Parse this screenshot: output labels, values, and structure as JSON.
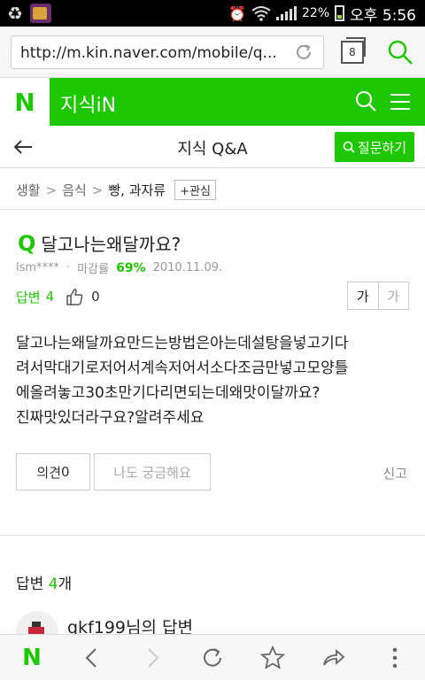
{
  "status_bar": {
    "battery_percent": "22%",
    "time": "오후 5:56",
    "icons": [
      "recycle-icon",
      "app-icon",
      "alarm-icon",
      "wifi-icon",
      "signal-icon",
      "battery-icon"
    ]
  },
  "browser": {
    "url": "http://m.kin.naver.com/mobile/q...",
    "tab_count": "8"
  },
  "header": {
    "logo": "N",
    "service_title": "지식iN"
  },
  "titlebar": {
    "title": "지식 Q&A",
    "ask_button": "질문하기"
  },
  "breadcrumb": {
    "items": [
      "생활",
      "음식",
      "빵, 과자류"
    ],
    "separator": ">",
    "interest_button": "+관심"
  },
  "question": {
    "mark": "Q",
    "title": "달고나는왜달까요?",
    "author": "lsm****",
    "deadline_label": "마감률",
    "deadline_rate": "69%",
    "date": "2010.11.09.",
    "answers_label": "답변",
    "answers_count": "4",
    "likes": "0",
    "font_small": "가",
    "font_large": "가",
    "body_lines": [
      "달고나는왜달까요만드는방법은아는데설탕을넣고기다",
      "려서막대기로저어서계속저어서소다조금만넣고모양틀",
      "에올려놓고30초만기다리면되는데왜맛이달까요?",
      "진짜맛있더라구요?알려주세요"
    ],
    "opinion_button": "의견",
    "opinion_count": "0",
    "curious_button": "나도 궁금해요",
    "report_link": "신고"
  },
  "answers": {
    "label": "답변",
    "count": "4",
    "unit": "개",
    "first_author": "qkf199님의 답변"
  },
  "colors": {
    "brand_green": "#1ec800"
  }
}
